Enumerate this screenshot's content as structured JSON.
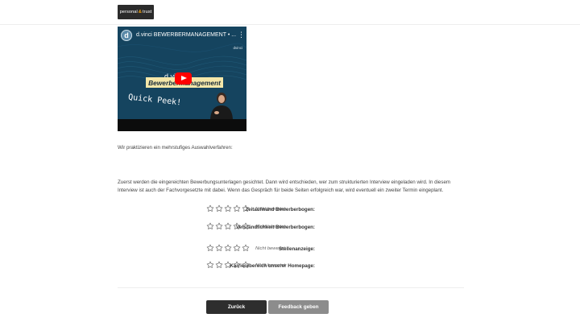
{
  "header": {
    "logo": {
      "word1": "personal",
      "amp": "&",
      "word2": "trust"
    }
  },
  "video": {
    "channel_initial": "d",
    "title": "d.vinci BEWERBERMANAGEMENT • ...",
    "menu_icon": "⋮",
    "brand": "dvinci",
    "banner_small": "d.vi",
    "banner": "Bewerbermanagement",
    "overlay_text": "Quick Peek!",
    "colors": {
      "background": "#143f58",
      "banner": "#f4e7a9",
      "play": "#ff0000"
    }
  },
  "intro_text": "Wir praktizieren ein mehrstufiges Auswahlverfahren:",
  "description": "Zuerst werden die eingereichten Bewerbungsunterlagen gesichtet. Dann wird entschieden, wer zum strukturierten Interview eingeladen wird. In diesem Interview ist auch der Fachvorgesetzte mit dabei. Wenn das Gespräch für beide Seiten erfolgreich war, wird eventuell ein zweiter Termin eingeplant.",
  "ratings": [
    {
      "label": "Zeitaufwand Bewerberbogen:",
      "stars": 0,
      "max_stars": 5,
      "status": "Nicht bewertet"
    },
    {
      "label": "Verständlichkeit Bewerberbogen:",
      "stars": 0,
      "max_stars": 5,
      "status": "Nicht bewertet"
    },
    {
      "label": "Stellenanzeige:",
      "stars": 0,
      "max_stars": 5,
      "status": "Nicht bewertet"
    },
    {
      "label": "Karrierebereich unserer Homepage:",
      "stars": 0,
      "max_stars": 5,
      "status": "Nicht bewertet"
    }
  ],
  "buttons": {
    "back": "Zurück",
    "feedback": "Feedback geben"
  },
  "icons": {
    "star": "star-outline-icon",
    "play": "youtube-play-icon",
    "menu": "kebab-menu-icon"
  }
}
